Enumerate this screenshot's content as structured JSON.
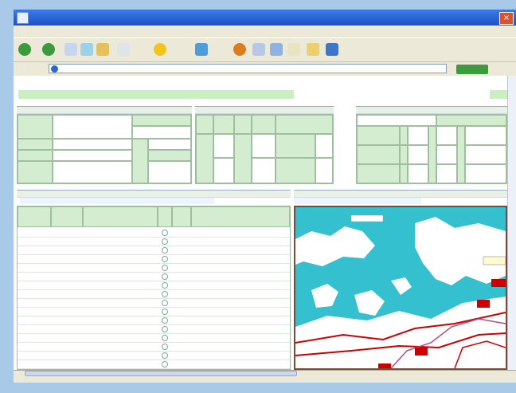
{
  "window": {
    "title": "",
    "close_glyph": "×"
  },
  "menu": {
    "items": [
      "",
      "",
      "",
      "",
      "",
      "",
      "",
      ""
    ]
  },
  "toolbar": {
    "buttons": [
      "",
      "",
      "",
      ""
    ]
  },
  "address": {
    "label": "",
    "url": "",
    "go_label": ""
  },
  "status": {
    "left": "",
    "zone": ""
  },
  "page": {
    "title": "",
    "subtitle": "",
    "section1_heading": "",
    "box_left_heading": "",
    "box_mid_heading": "",
    "box_right_heading": "",
    "sheet_list_heading": "",
    "sheet_list_link": "",
    "map_heading": "",
    "map_link": ""
  },
  "sheet_table": {
    "columns": [
      "",
      "",
      "",
      "",
      "",
      ""
    ],
    "rows": [
      {
        "c1": "",
        "c2": "",
        "c3": ""
      },
      {
        "c1": "",
        "c2": "",
        "c3": ""
      },
      {
        "c1": "",
        "c2": "",
        "c3": ""
      },
      {
        "c1": "",
        "c2": "",
        "c3": ""
      },
      {
        "c1": "",
        "c2": "",
        "c3": ""
      },
      {
        "c1": "",
        "c2": "",
        "c3": ""
      },
      {
        "c1": "",
        "c2": "",
        "c3": ""
      },
      {
        "c1": "",
        "c2": "",
        "c3": ""
      },
      {
        "c1": "",
        "c2": "",
        "c3": ""
      },
      {
        "c1": "",
        "c2": "",
        "c3": ""
      },
      {
        "c1": "",
        "c2": "",
        "c3": ""
      },
      {
        "c1": "",
        "c2": "",
        "c3": ""
      },
      {
        "c1": "",
        "c2": "",
        "c3": ""
      },
      {
        "c1": "",
        "c2": "",
        "c3": ""
      },
      {
        "c1": "",
        "c2": "",
        "c3": ""
      },
      {
        "c1": "",
        "c2": "",
        "c3": ""
      }
    ]
  },
  "colors": {
    "header_green": "#d4ecd0",
    "title_green": "#c8f0c0",
    "link_blue": "#1a3fd6",
    "sea": "#35c0d0",
    "road_red": "#cc0000"
  }
}
